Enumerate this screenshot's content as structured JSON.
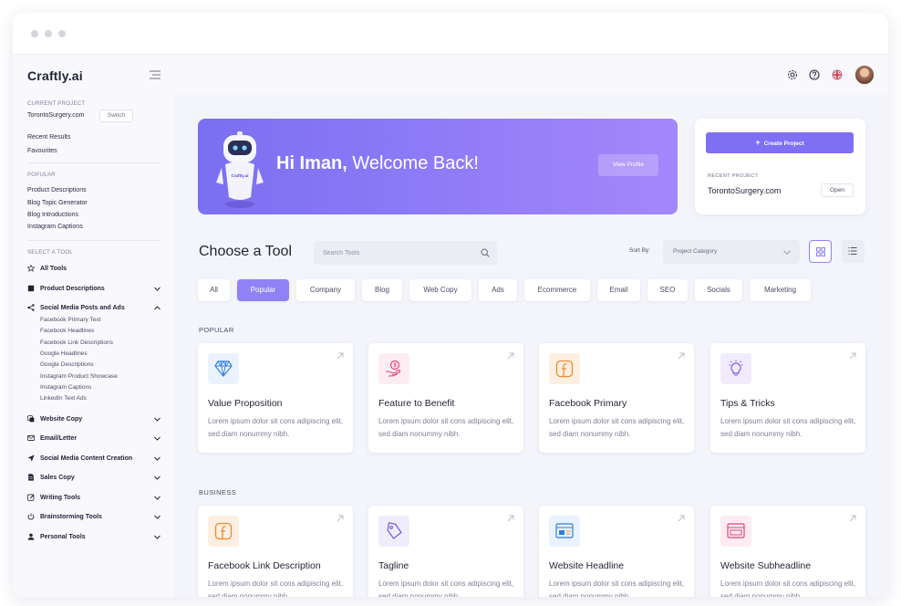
{
  "app": {
    "name": "Craftly.ai"
  },
  "sidebar": {
    "current_project_label": "CURRENT PROJECT",
    "current_project": "TorontoSurgery.com",
    "switch_label": "Switch",
    "recent_results": "Recent Results",
    "favourites": "Favourites",
    "popular_label": "POPULAR",
    "popular_items": [
      "Product Descriptions",
      "Blog Topic Generator",
      "Blog Introductions",
      "Instagram Captions"
    ],
    "select_tool_label": "SELECT A TOOL",
    "tools": [
      {
        "label": "All Tools",
        "icon": "star-icon"
      },
      {
        "label": "Product Descriptions",
        "icon": "box-icon"
      },
      {
        "label": "Social Media Posts and Ads",
        "icon": "share-icon"
      },
      {
        "label": "Website Copy",
        "icon": "copy-icon"
      },
      {
        "label": "Email/Letter",
        "icon": "mail-icon"
      },
      {
        "label": "Social Media Content Creation",
        "icon": "send-icon"
      },
      {
        "label": "Sales Copy",
        "icon": "document-icon"
      },
      {
        "label": "Writing Tools",
        "icon": "edit-icon"
      },
      {
        "label": "Brainstorming Tools",
        "icon": "power-icon"
      },
      {
        "label": "Personal Tools",
        "icon": "user-icon"
      }
    ],
    "social_subitems": [
      "Facebook Primary Text",
      "Facebook Headlines",
      "Facebook Link Descriptions",
      "Google Headlines",
      "Google Descriptions",
      "Instagram Product Showcase",
      "Instagram Captions",
      "LinkedIn Text Ads"
    ]
  },
  "banner": {
    "greeting_name": "Hi Iman,",
    "greeting_rest": " Welcome Back!",
    "view_profile": "View Profile",
    "robot_label": "Craftly.ai"
  },
  "project_card": {
    "create_label": "Create Project",
    "recent_label": "RECENT PROJECT",
    "recent_name": "TorontoSurgery.com",
    "open_label": "Open"
  },
  "tools_section": {
    "title": "Choose a Tool",
    "search_placeholder": "Search Tools",
    "sort_label": "Sort By:",
    "sort_value": "Project Category"
  },
  "tabs": [
    "All",
    "Popular",
    "Company",
    "Blog",
    "Web Copy",
    "Ads",
    "Ecommerce",
    "Email",
    "SEO",
    "Socials",
    "Marketing"
  ],
  "active_tab": "Popular",
  "sections": [
    {
      "label": "POPULAR",
      "cards": [
        {
          "title": "Value Proposition",
          "desc": "Lorem ipsum dolor sit cons adipiscing elit, sed diam nonummy nibh.",
          "icon": "diamond-icon",
          "color": "#2f7fd8",
          "bg": "#eaf3fd"
        },
        {
          "title": "Feature to Benefit",
          "desc": "Lorem ipsum dolor sit cons adipiscing elit, sed diam nonummy nibh.",
          "icon": "hand-coin-icon",
          "color": "#e0447a",
          "bg": "#fdecf2"
        },
        {
          "title": "Facebook Primary",
          "desc": "Lorem ipsum dolor sit cons adipiscing elit, sed diam nonummy nibh.",
          "icon": "facebook-icon",
          "color": "#f08a2c",
          "bg": "#fdefe1"
        },
        {
          "title": "Tips & Tricks",
          "desc": "Lorem ipsum dolor sit cons adipiscing elit, sed diam nonummy nibh.",
          "icon": "lightbulb-icon",
          "color": "#7c5ce8",
          "bg": "#f0ecfd"
        }
      ]
    },
    {
      "label": "BUSINESS",
      "cards": [
        {
          "title": "Facebook Link Description",
          "desc": "Lorem ipsum dolor sit cons adipiscing elit, sed diam nonummy nibh.",
          "icon": "facebook-icon",
          "color": "#f08a2c",
          "bg": "#fdefe1"
        },
        {
          "title": "Tagline",
          "desc": "Lorem ipsum dolor sit cons adipiscing elit, sed diam nonummy nibh.",
          "icon": "tag-icon",
          "color": "#6a58d8",
          "bg": "#efedfc"
        },
        {
          "title": "Website Headline",
          "desc": "Lorem ipsum dolor sit cons adipiscing elit, sed diam nonummy nibh.",
          "icon": "browser-icon",
          "color": "#2f7fd8",
          "bg": "#eaf3fd"
        },
        {
          "title": "Website Subheadline",
          "desc": "Lorem ipsum dolor sit cons adipiscing elit, sed diam nonummy nibh.",
          "icon": "browser-icon",
          "color": "#e0447a",
          "bg": "#fdecf2"
        }
      ]
    }
  ]
}
